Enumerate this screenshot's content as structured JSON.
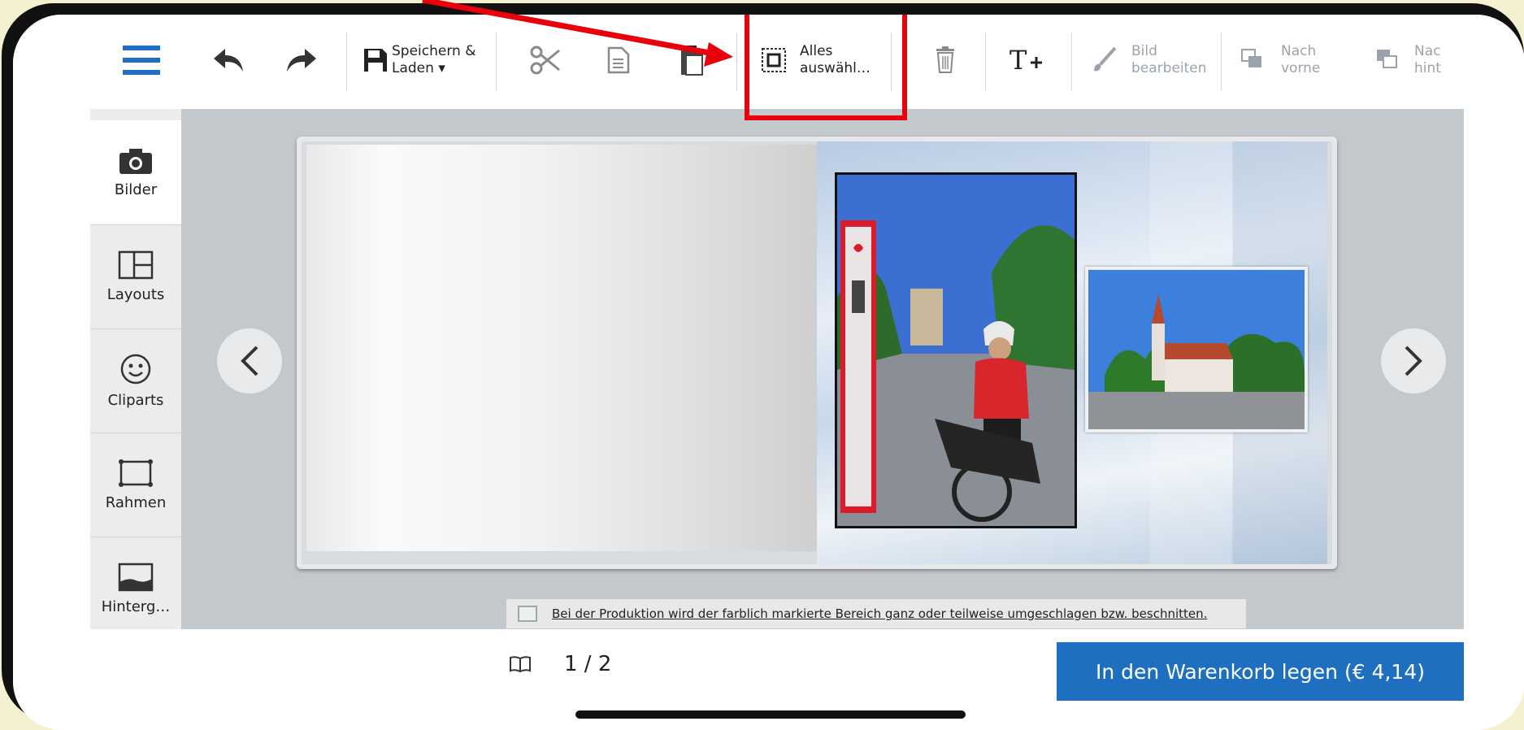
{
  "toolbar": {
    "menu_icon": "hamburger-menu-icon",
    "save_label_line1": "Speichern &",
    "save_label_line2": "Laden ▾",
    "select_all_line1": "Alles",
    "select_all_line2": "auswähl…",
    "edit_image_line1": "Bild",
    "edit_image_line2": "bearbeiten",
    "forward_line1": "Nach",
    "forward_line2": "vorne",
    "backward_line1": "Nac",
    "backward_line2": "hint"
  },
  "sidebar": {
    "items": [
      {
        "label": "Bilder",
        "icon": "camera-icon",
        "active": true
      },
      {
        "label": "Layouts",
        "icon": "layout-icon",
        "active": false
      },
      {
        "label": "Cliparts",
        "icon": "smiley-icon",
        "active": false
      },
      {
        "label": "Rahmen",
        "icon": "frame-icon",
        "active": false
      },
      {
        "label": "Hinterg…",
        "icon": "background-icon",
        "active": false
      }
    ]
  },
  "canvas": {
    "notice": "Bei der Produktion wird der farblich markierte Bereich ganz oder teilweise umgeschlagen bzw. beschnitten."
  },
  "footer": {
    "page_indicator": "1 / 2",
    "cart_button": "In den Warenkorb legen (€ 4,14)"
  },
  "colors": {
    "accent": "#1e6fbf",
    "annotation": "#e8000b",
    "corner_marker": "#7cc242"
  }
}
